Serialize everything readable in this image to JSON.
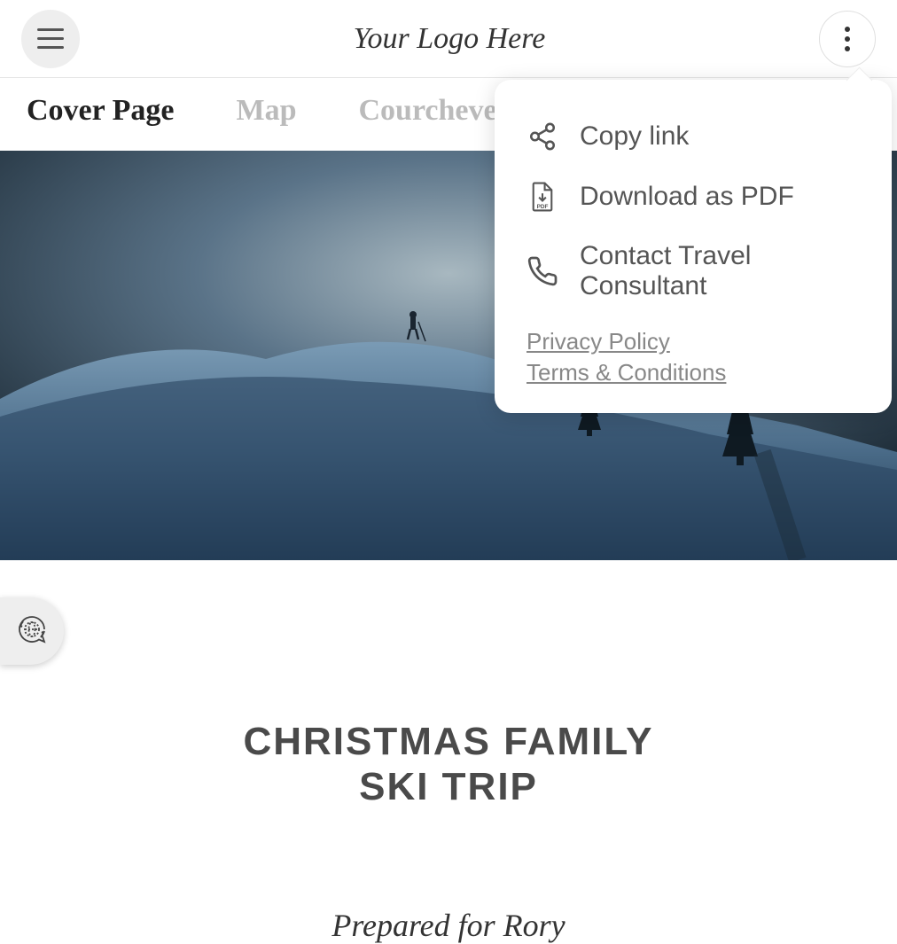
{
  "header": {
    "logo": "Your Logo Here"
  },
  "tabs": [
    {
      "label": "Cover Page",
      "active": true
    },
    {
      "label": "Map",
      "active": false
    },
    {
      "label": "Courchevel",
      "active": false
    }
  ],
  "dropdown": {
    "items": [
      {
        "label": "Copy link",
        "icon": "share-icon"
      },
      {
        "label": "Download as PDF",
        "icon": "pdf-icon"
      },
      {
        "label": "Contact Travel Consultant",
        "icon": "phone-icon"
      }
    ],
    "links": [
      {
        "label": "Privacy Policy"
      },
      {
        "label": "Terms & Conditions"
      }
    ]
  },
  "content": {
    "title_line1": "CHRISTMAS FAMILY",
    "title_line2": "SKI TRIP",
    "subtitle": "Prepared for Rory"
  }
}
